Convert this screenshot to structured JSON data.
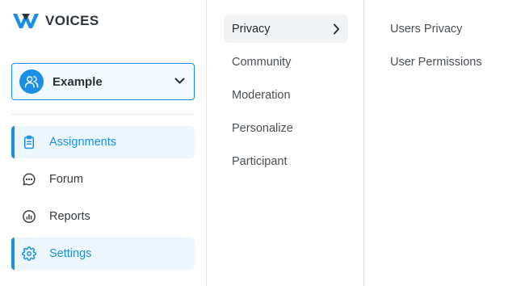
{
  "brand": {
    "name": "VOICES",
    "logo_icon": "voices-logo-icon",
    "accent": "#1a8fe6"
  },
  "workspace": {
    "name": "Example",
    "icon": "users-icon",
    "chevron": "chevron-down-icon"
  },
  "nav": [
    {
      "label": "Assignments",
      "icon": "clipboard-icon",
      "active": true
    },
    {
      "label": "Forum",
      "icon": "chat-bubble-icon",
      "active": false
    },
    {
      "label": "Reports",
      "icon": "chart-icon",
      "active": false
    },
    {
      "label": "Settings",
      "icon": "gear-icon",
      "active": true
    }
  ],
  "categories": [
    {
      "label": "Privacy",
      "active": true,
      "icon": "chevron-right-icon"
    },
    {
      "label": "Community",
      "active": false
    },
    {
      "label": "Moderation",
      "active": false
    },
    {
      "label": "Personalize",
      "active": false
    },
    {
      "label": "Participant",
      "active": false
    }
  ],
  "submenu": [
    {
      "label": "Users Privacy"
    },
    {
      "label": "User Permissions"
    }
  ]
}
